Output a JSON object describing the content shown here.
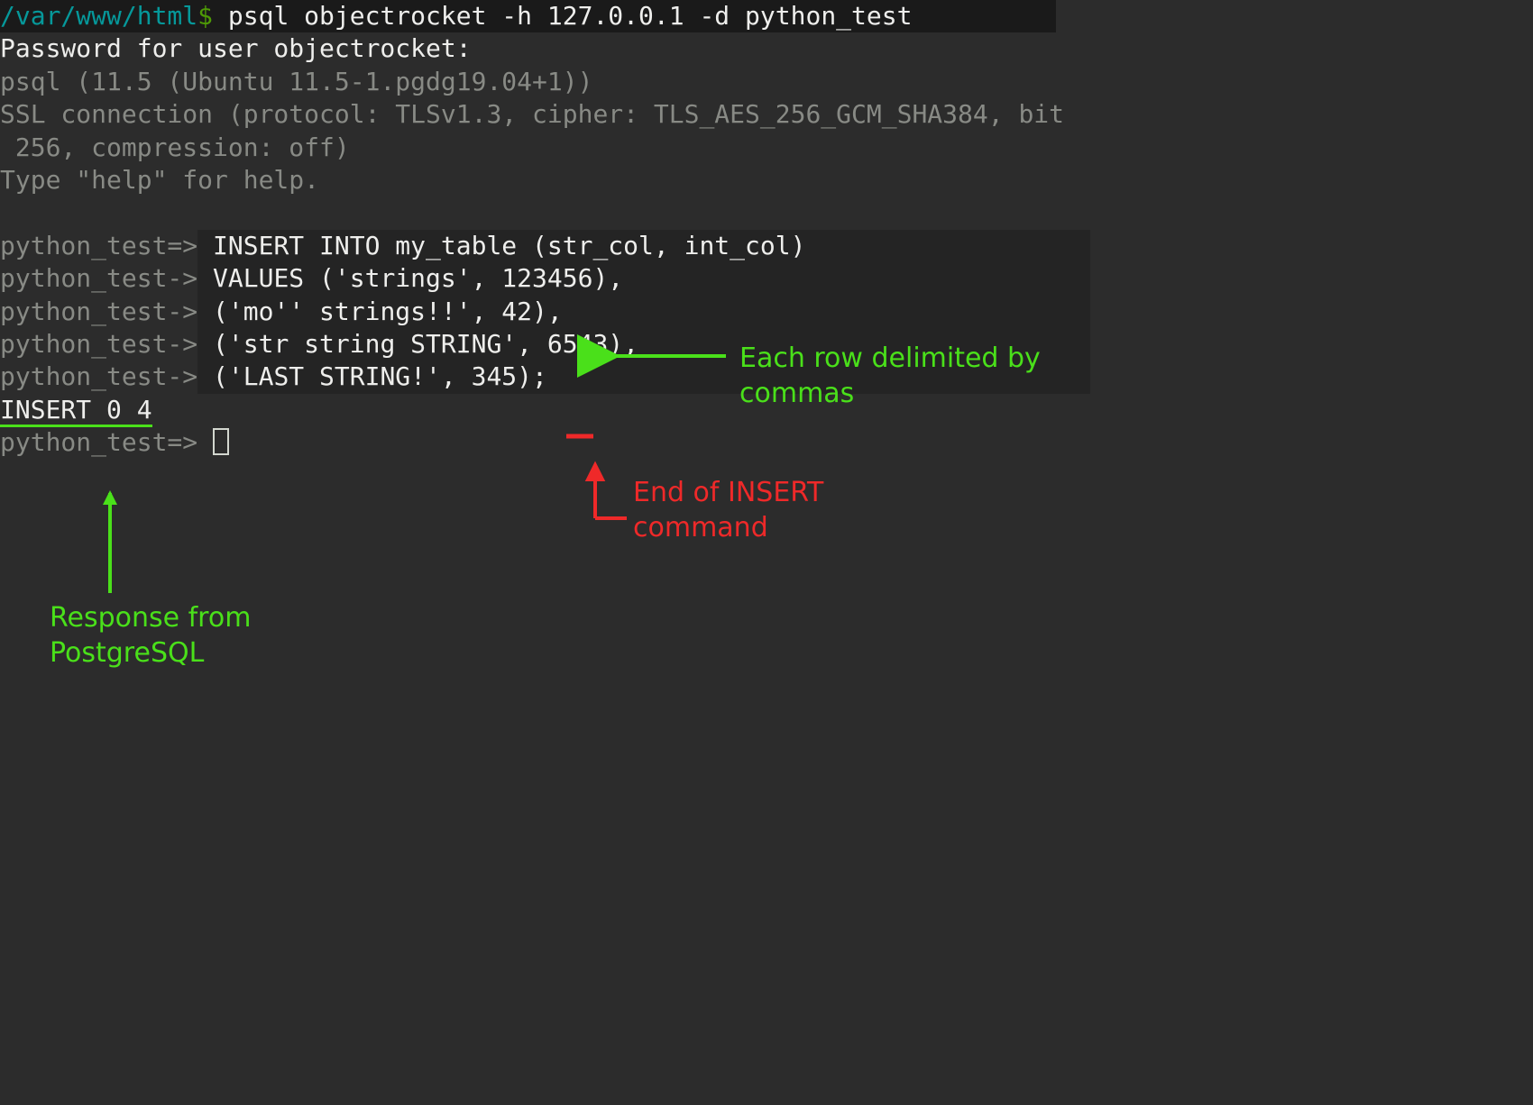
{
  "line1": {
    "path": "/var/www/html",
    "dollar": "$",
    "command": " psql objectrocket -h 127.0.0.1 -d python_test"
  },
  "line2": "Password for user objectrocket:",
  "line3": "psql (11.5 (Ubuntu 11.5-1.pgdg19.04+1))",
  "line4": "SSL connection (protocol: TLSv1.3, cipher: TLS_AES_256_GCM_SHA384, bit",
  "line5": " 256, compression: off)",
  "line6": "Type \"help\" for help.",
  "insert": {
    "p1": "python_test=>",
    "p2": "python_test->",
    "l1": " INSERT INTO my_table (str_col, int_col)",
    "l2": " VALUES ('strings', 123456),",
    "l3": " ('mo'' strings!!', 42),",
    "l4": " ('str string STRING', 6543),",
    "l5": " ('LAST STRING!', 345);"
  },
  "response": "INSERT 0 4",
  "final_prompt": "python_test=> ",
  "annotations": {
    "rows_delim": "Each row delimited by",
    "rows_delim2": "commas",
    "end_insert": "End of INSERT",
    "end_insert2": "command",
    "response_from": "Response from",
    "response_from2": "PostgreSQL"
  }
}
